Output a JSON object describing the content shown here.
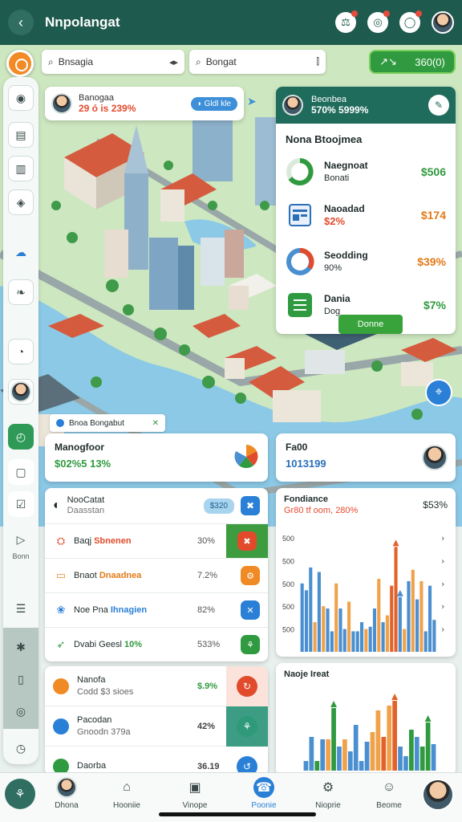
{
  "appbar": {
    "title": "Nnpolangat",
    "back_icon": "arrow-left-icon",
    "icons": [
      "user-search-icon",
      "globe-icon",
      "bell-icon"
    ]
  },
  "search": {
    "left_value": "Bnsagia",
    "right_value": "Bongat",
    "left_tail": "◂▸",
    "right_tail": "⫿"
  },
  "stat_pill": {
    "icon": "↗↘",
    "value": "360(0)"
  },
  "profile_card": {
    "name": "Banogaa",
    "value": "29 ó is 239%",
    "chip": "Gldl kle",
    "chip_icon": "◗"
  },
  "projects": {
    "header_title": "Beonbea",
    "header_sub": "570% 5999%",
    "title": "Nona Btoojmea",
    "rows": [
      {
        "name": "Naegnoat",
        "sub": "Bonati",
        "amount": "$506",
        "color": "#2f9a3f"
      },
      {
        "name": "Naoadad",
        "sub": "$2%",
        "amount": "$174",
        "color": "#e37a18"
      },
      {
        "name": "Seodding",
        "sub": "90%",
        "amount": "$39%",
        "color": "#e37a18"
      },
      {
        "name": "Dania",
        "sub": "Dog",
        "amount": "$7%",
        "color": "#2f9a3f"
      }
    ],
    "button": "Donne"
  },
  "tag_chip": {
    "label": "Bnoa Bongabut",
    "close": "✕"
  },
  "manager_card": {
    "name": "Manogfoor",
    "value": "$02%5 13%"
  },
  "report_card": {
    "name": "Fa00",
    "value": "1013199"
  },
  "list": {
    "head_title": "NooCatat",
    "head_sub": "Daasstan",
    "badge": "$320",
    "rows": [
      {
        "label": "Baqj",
        "accent": "Sbnenen",
        "pct": "30%",
        "icon": "⛭",
        "btn": "✖",
        "btn_color": "#e14b2c",
        "accent_color": "#e14b2c",
        "highlight": true
      },
      {
        "label": "Bnaot",
        "accent": "Dnaadnea",
        "pct": "7.2%",
        "icon": "▭",
        "btn": "⚙",
        "btn_color": "#f08a24",
        "accent_color": "#e37a18",
        "highlight": false
      },
      {
        "label": "Noe Pna",
        "accent": "Ihnagien",
        "pct": "82%",
        "icon": "❀",
        "btn": "✕",
        "btn_color": "#2a7fd6",
        "accent_color": "#2a7fd6",
        "highlight": false
      },
      {
        "label": "Dvabi Geesl",
        "accent": "10%",
        "pct": "533%",
        "icon": "➶",
        "btn": "⚘",
        "btn_color": "#2f9a3f",
        "accent_color": "#2f9a3f",
        "highlight": false
      }
    ]
  },
  "list2": {
    "rows": [
      {
        "title": "Nanofa",
        "sub": "Codd $3 sioes",
        "pct": "$.9%",
        "pct_color": "#2f9a3f",
        "icon_color": "#f08a24",
        "btn_color": "#e14b2c",
        "btn_bg": "#fbe3dc",
        "btn": "↻"
      },
      {
        "title": "Pacodan",
        "sub": "Gnoodn 379a",
        "pct": "42%",
        "pct_color": "#444",
        "icon_color": "#2a7fd6",
        "btn_color": "#2f9a7a",
        "btn_bg": "#3c9c84",
        "btn": "⚘"
      },
      {
        "title": "Daorba",
        "sub": "",
        "pct": "36.19",
        "pct_color": "#444",
        "icon_color": "#2f9a3f",
        "btn_color": "#2a7fd6",
        "btn_bg": "#ffffff",
        "btn": "↺"
      }
    ]
  },
  "chart_data": [
    {
      "type": "bar",
      "title": "Fondiance",
      "subtitle": "Gr80 tf oom, 280%",
      "right_value": "$53%",
      "ytick_labels": [
        "500",
        "500",
        "500",
        "500",
        "500"
      ],
      "values": [
        3.0,
        2.7,
        3.7,
        1.3,
        3.5,
        2.0,
        1.9,
        0.9,
        3.0,
        1.9,
        1.0,
        2.2,
        0.9,
        0.9,
        1.3,
        1.0,
        1.1,
        1.9,
        3.2,
        1.3,
        1.6,
        2.9,
        4.6,
        2.4,
        1.0,
        3.1,
        3.6,
        2.3,
        3.1,
        0.9,
        2.9,
        1.4
      ],
      "colors": [
        "#4a8fd0",
        "#4a8fd0",
        "#4a8fd0",
        "#f0a24a",
        "#4a8fd0",
        "#f0a24a",
        "#4a8fd0",
        "#4a8fd0",
        "#f0a24a",
        "#4a8fd0",
        "#4a8fd0",
        "#f0a24a",
        "#4a8fd0",
        "#4a8fd0",
        "#4a8fd0",
        "#f0a24a",
        "#4a8fd0",
        "#4a8fd0",
        "#f0a24a",
        "#4a8fd0",
        "#f0a24a",
        "#e3622b",
        "#e3622b",
        "#4a8fd0",
        "#f0a24a",
        "#4a8fd0",
        "#f0a24a",
        "#4a8fd0",
        "#f0a24a",
        "#4a8fd0",
        "#4a8fd0",
        "#4a8fd0"
      ],
      "arrows_at": [
        22,
        23
      ],
      "ylim": [
        0,
        5
      ]
    },
    {
      "type": "bar",
      "title": "Naoje Ireat",
      "values": [
        0.4,
        1.4,
        0.4,
        1.3,
        1.3,
        2.6,
        1.0,
        1.3,
        0.8,
        1.9,
        0.4,
        1.2,
        1.6,
        2.5,
        1.4,
        2.7,
        2.9,
        1.0,
        0.6,
        1.7,
        1.4,
        1.0,
        2.0,
        1.1
      ],
      "colors": [
        "#4a8fd0",
        "#4a8fd0",
        "#2f9a3f",
        "#4a8fd0",
        "#f0a24a",
        "#2f9a3f",
        "#4a8fd0",
        "#f0a24a",
        "#4a8fd0",
        "#4a8fd0",
        "#4a8fd0",
        "#4a8fd0",
        "#f0a24a",
        "#f0a24a",
        "#e3622b",
        "#f0a24a",
        "#e3622b",
        "#4a8fd0",
        "#4a8fd0",
        "#2f9a3f",
        "#4a8fd0",
        "#2f9a3f",
        "#2f9a3f",
        "#4a8fd0"
      ],
      "arrows_at": [
        5,
        16,
        22
      ],
      "ylim": [
        0,
        3
      ]
    }
  ],
  "sidebar": {
    "label_mid": "Bonn",
    "items": [
      "circle-target-icon",
      "calendar-icon",
      "clipboard-icon",
      "tag-icon",
      "cloud-icon",
      "leaf-icon",
      "pie-icon",
      "avatar",
      "timer-icon",
      "square-icon",
      "checklist-icon",
      "play-icon",
      "document-icon",
      "puzzle-icon",
      "clipboard-icon",
      "settings-icon",
      "clock-icon"
    ]
  },
  "bottomnav": {
    "items": [
      {
        "label": "Dhona",
        "icon": "avatar"
      },
      {
        "label": "Hooniie",
        "icon": "⌂"
      },
      {
        "label": "Vinope",
        "icon": "▣"
      },
      {
        "label": "Poonie",
        "icon": "☎",
        "active": true
      },
      {
        "label": "Nioprie",
        "icon": "⚙"
      },
      {
        "label": "Beome",
        "icon": "☺"
      }
    ]
  }
}
